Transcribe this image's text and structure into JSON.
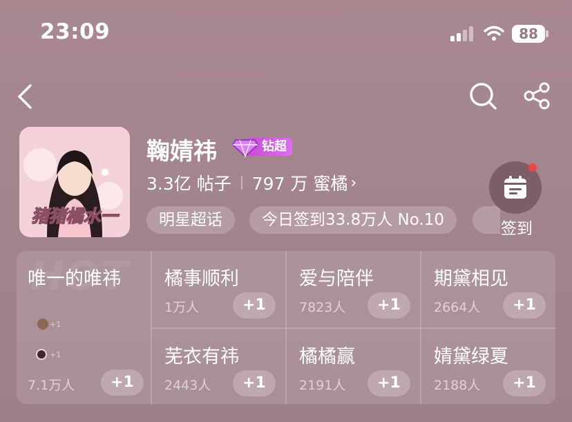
{
  "status_bar": {
    "time": "23:09",
    "battery": "88"
  },
  "nav": {
    "back_icon": "chevron-left-icon",
    "search_icon": "search-icon",
    "share_icon": "share-icon"
  },
  "header": {
    "title": "鞠婧祎",
    "badge_label": "钻超",
    "posts_value": "3.3亿",
    "posts_label": "帖子",
    "fans_value": "797 万",
    "fans_label": "蜜橘",
    "fans_chevron": "›",
    "avatar_text": "猪猪橘水一"
  },
  "tags": [
    {
      "label": "明星超话"
    },
    {
      "label": "今日签到33.8万人 No.10"
    }
  ],
  "checkin": {
    "label": "签到",
    "icon": "calendar-icon"
  },
  "groups": {
    "watermark": "HOT",
    "plus_label": "+1",
    "mini_plus": "+1",
    "featured": {
      "name": "唯一的唯祎",
      "count": "7.1万人"
    },
    "items": [
      {
        "name": "橘事顺利",
        "count": "1万人"
      },
      {
        "name": "爱与陪伴",
        "count": "7823人"
      },
      {
        "name": "期黛相见",
        "count": "2664人"
      },
      {
        "name": "芜衣有祎",
        "count": "2443人"
      },
      {
        "name": "橘橘赢",
        "count": "2191人"
      },
      {
        "name": "婧黛绿夏",
        "count": "2188人"
      }
    ]
  },
  "colors": {
    "background": "#a4858d",
    "badge": "#c64bd9",
    "notification_dot": "#f04444"
  }
}
